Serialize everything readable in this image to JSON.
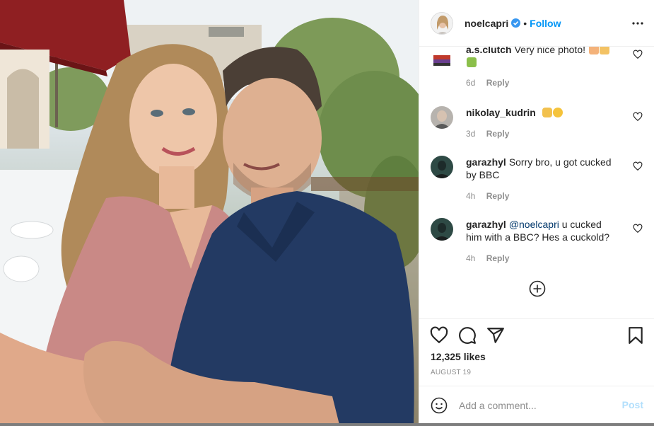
{
  "post": {
    "author": {
      "username": "noelcapri",
      "verified": true,
      "separator": "•",
      "follow_label": "Follow"
    },
    "comments": [
      {
        "username": "a.s.clutch",
        "text": "Very nice photo!",
        "emojis": [
          "picture-emoji",
          "clapping-emoji",
          "bouquet-emoji"
        ],
        "time": "6d",
        "reply_label": "Reply"
      },
      {
        "username": "nikolay_kudrin",
        "text": "",
        "emojis": [
          "raised-hands-emoji",
          "laughing-emoji"
        ],
        "time": "3d",
        "reply_label": "Reply"
      },
      {
        "username": "garazhyl",
        "text": "Sorry bro, u got cucked by BBC",
        "time": "4h",
        "reply_label": "Reply"
      },
      {
        "username": "garazhyl",
        "mention": "@noelcapri",
        "text": "u cucked him with a BBC? Hes a cuckold?",
        "time": "4h",
        "reply_label": "Reply"
      }
    ],
    "likes": "12,325 likes",
    "date": "August 19",
    "add_comment": {
      "placeholder": "Add a comment...",
      "value": "",
      "post_label": "Post"
    },
    "colors": {
      "accent": "#0095f6",
      "post_disabled": "#b2dffc",
      "muted": "#8e8e8e",
      "text": "#262626"
    },
    "icons": {
      "more": "more-horizontal-icon",
      "verified": "verified-badge-icon",
      "like": "heart-icon",
      "comment": "comment-bubble-icon",
      "share": "paper-plane-icon",
      "save": "bookmark-icon",
      "load_more": "plus-circle-icon",
      "emoji": "smile-icon"
    }
  }
}
